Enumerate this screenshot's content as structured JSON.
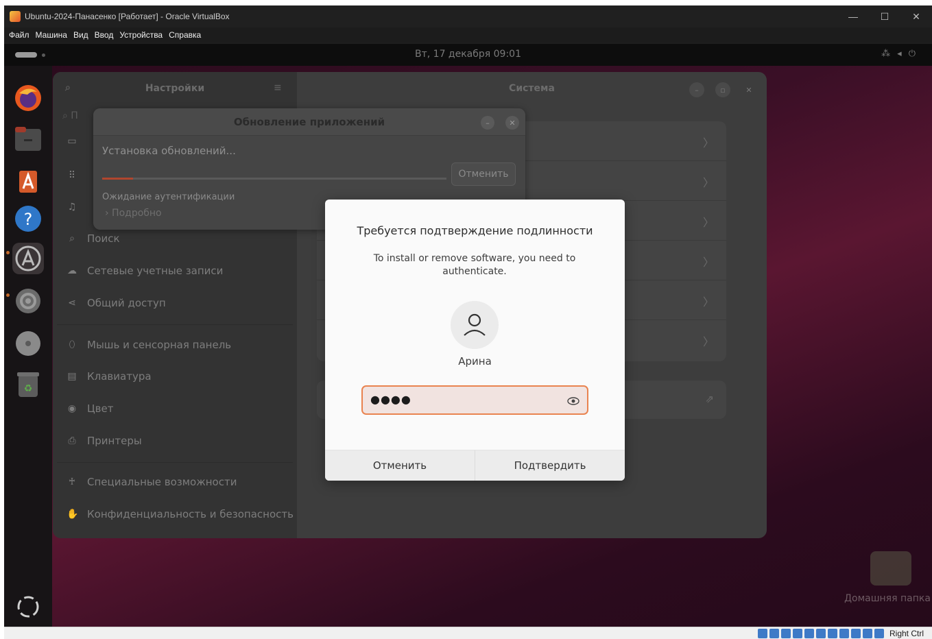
{
  "vbox": {
    "title": "Ubuntu-2024-Панасенко [Работает] - Oracle VirtualBox",
    "menu": [
      "Файл",
      "Машина",
      "Вид",
      "Ввод",
      "Устройства",
      "Справка"
    ],
    "host_key": "Right Ctrl"
  },
  "topbar": {
    "clock": "Вт, 17 декабря  09:01"
  },
  "settings": {
    "sidebar_title": "Настройки",
    "main_title": "Система",
    "search_placeholder": "П",
    "sidebar_items": [
      "Поиск",
      "Сетевые учетные записи",
      "Общий доступ",
      "Мышь и сенсорная панель",
      "Клавиатура",
      "Цвет",
      "Принтеры",
      "Специальные возможности",
      "Конфиденциальность и безопасность"
    ]
  },
  "update_dialog": {
    "title": "Обновление приложений",
    "step": "Установка обновлений...",
    "cancel": "Отменить",
    "status": "Ожидание аутентификации",
    "details": "› Подробно",
    "progress": 0.09
  },
  "auth_dialog": {
    "heading": "Требуется подтверждение подлинности",
    "message": "To install or remove software, you need to authenticate.",
    "user": "Арина",
    "password_masked": "●●●●",
    "cancel": "Отменить",
    "confirm": "Подтвердить"
  },
  "desktop": {
    "home_folder": "Домашняя папка"
  }
}
